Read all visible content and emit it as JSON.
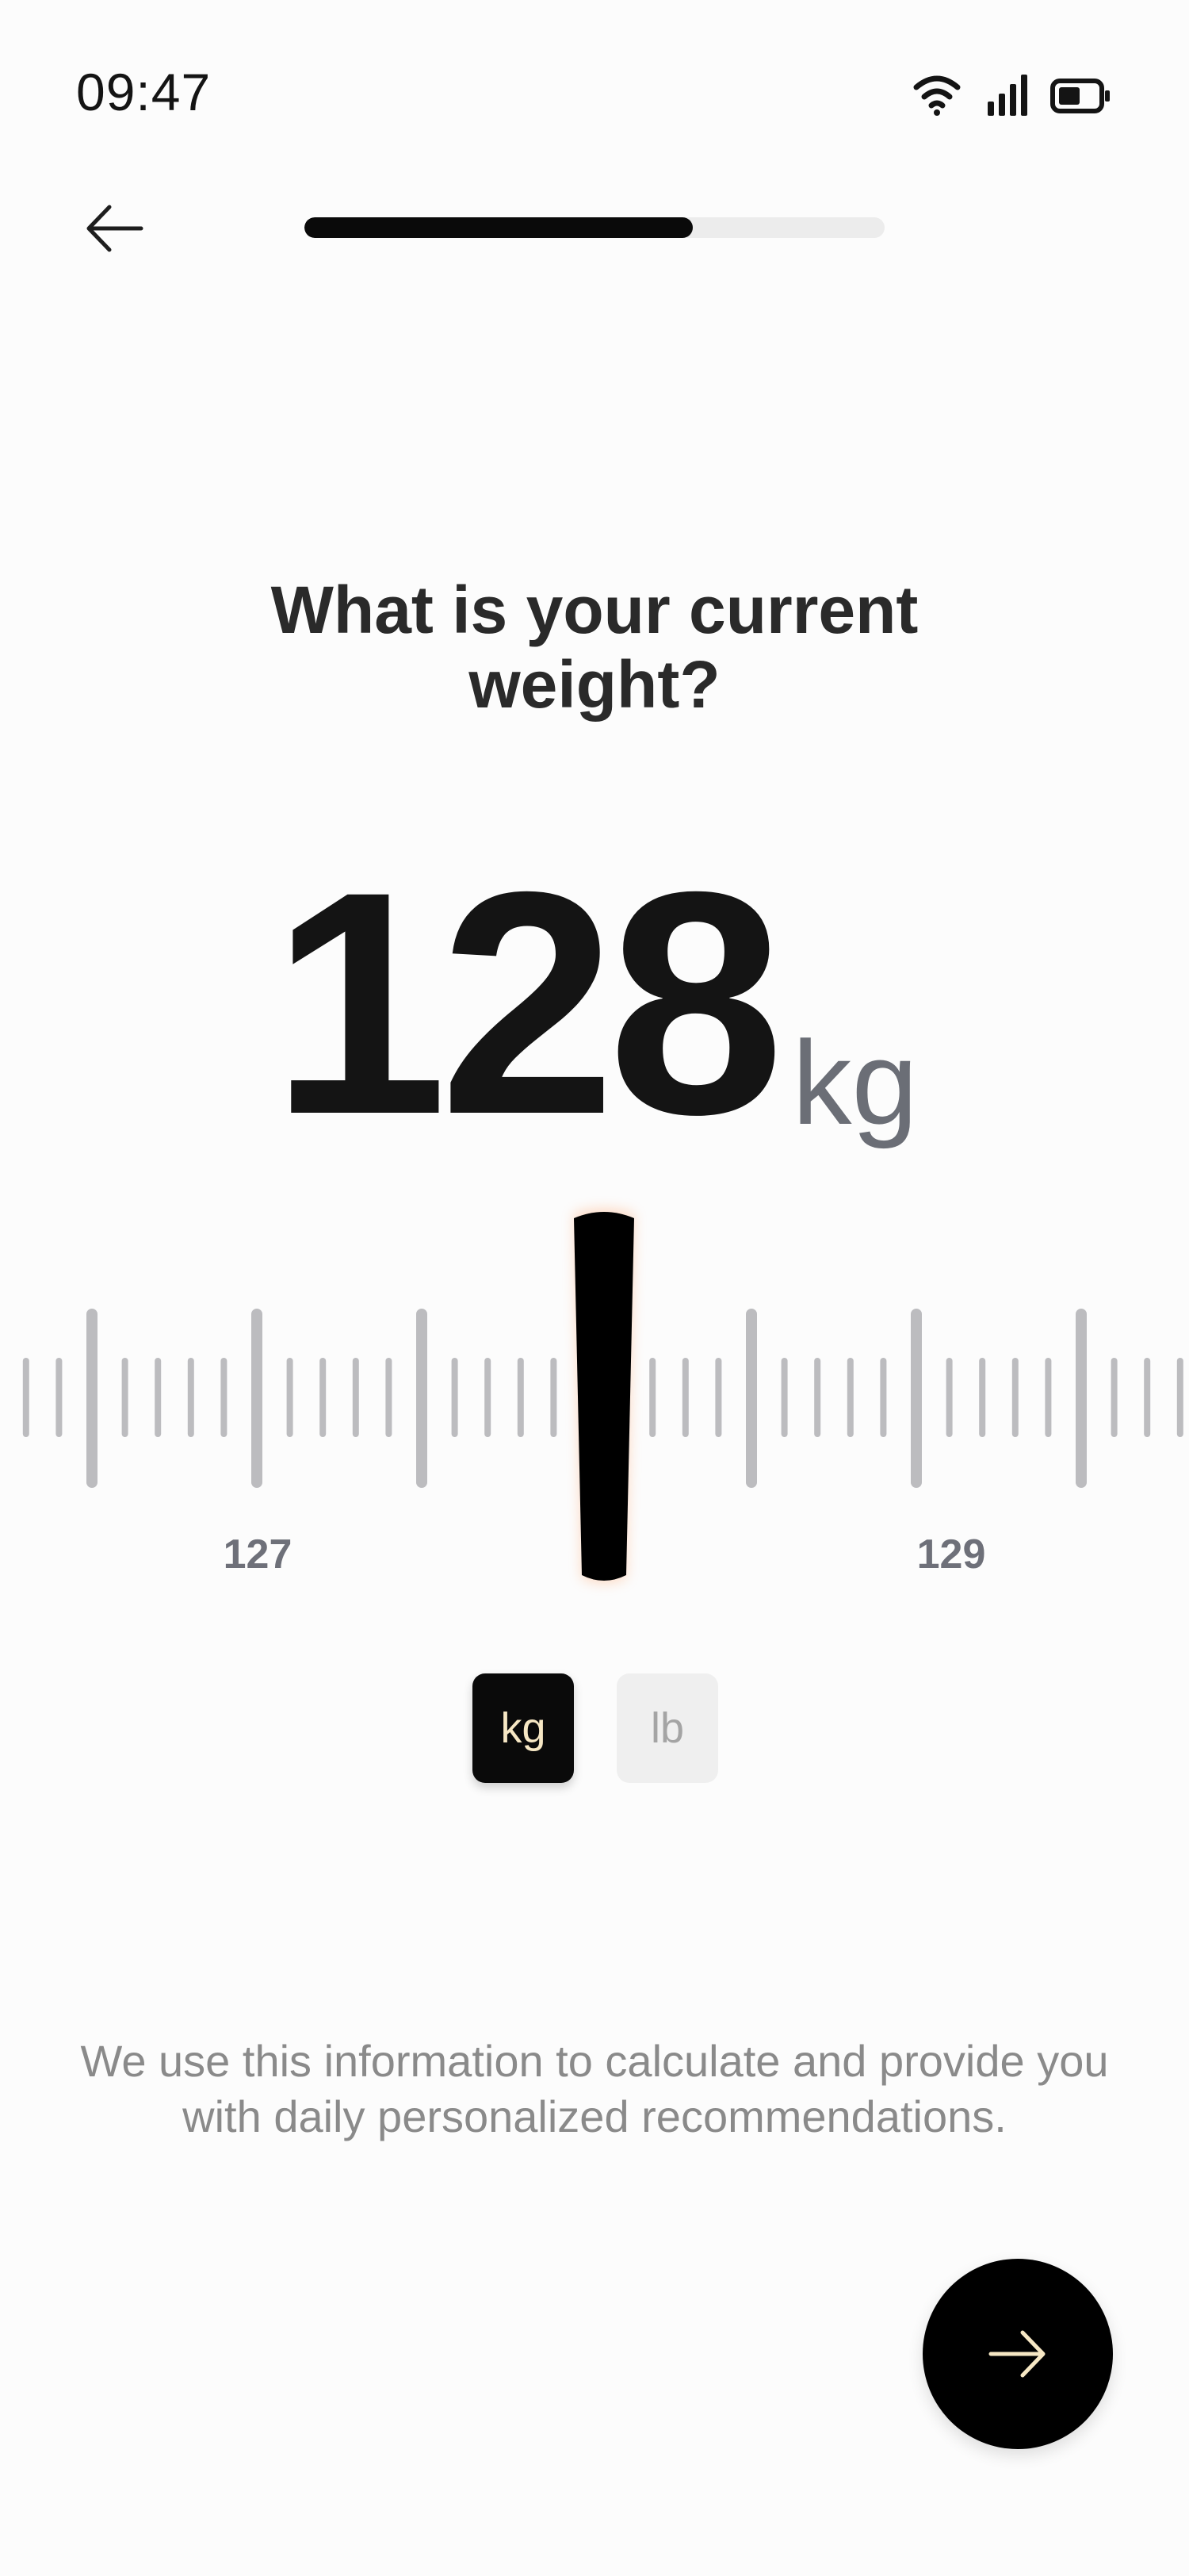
{
  "status_bar": {
    "time": "09:47",
    "icons": [
      "wifi-icon",
      "signal-icon",
      "battery-icon"
    ]
  },
  "header": {
    "back_icon": "arrow-left-icon",
    "progress_fraction": 0.67
  },
  "question": {
    "title": "What is your current weight?"
  },
  "weight": {
    "value": "128",
    "unit": "kg"
  },
  "ruler": {
    "labels": [
      "127",
      "129"
    ],
    "selected_value": 128,
    "colors": {
      "tick": "#bcbcbf",
      "needle": "#000000",
      "needle_glow": "#ff9a5c"
    }
  },
  "unit_toggle": {
    "options": [
      {
        "label": "kg",
        "selected": true
      },
      {
        "label": "lb",
        "selected": false
      }
    ]
  },
  "info": {
    "text": "We use this information to calculate and provide you with daily personalized recommendations."
  },
  "next_button": {
    "icon": "arrow-right-icon",
    "icon_color": "#f6e7c4"
  }
}
